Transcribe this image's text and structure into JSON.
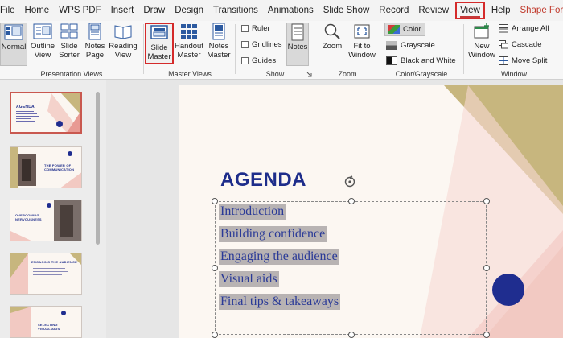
{
  "tabs": [
    {
      "label": "File"
    },
    {
      "label": "Home"
    },
    {
      "label": "WPS PDF"
    },
    {
      "label": "Insert"
    },
    {
      "label": "Draw"
    },
    {
      "label": "Design"
    },
    {
      "label": "Transitions"
    },
    {
      "label": "Animations"
    },
    {
      "label": "Slide Show"
    },
    {
      "label": "Record"
    },
    {
      "label": "Review"
    },
    {
      "label": "View"
    },
    {
      "label": "Help"
    },
    {
      "label": "Shape Format"
    }
  ],
  "ribbon": {
    "presentation_views": {
      "label": "Presentation Views",
      "normal": "Normal",
      "outline": [
        "Outline",
        "View"
      ],
      "sorter": [
        "Slide",
        "Sorter"
      ],
      "notes_page": [
        "Notes",
        "Page"
      ],
      "reading": [
        "Reading",
        "View"
      ]
    },
    "master_views": {
      "label": "Master Views",
      "slide_master": [
        "Slide",
        "Master"
      ],
      "handout_master": [
        "Handout",
        "Master"
      ],
      "notes_master": [
        "Notes",
        "Master"
      ]
    },
    "show": {
      "label": "Show",
      "ruler": "Ruler",
      "gridlines": "Gridlines",
      "guides": "Guides",
      "notes": "Notes"
    },
    "zoom": {
      "label": "Zoom",
      "zoom": "Zoom",
      "fit": [
        "Fit to",
        "Window"
      ]
    },
    "color": {
      "label": "Color/Grayscale",
      "color": "Color",
      "grayscale": "Grayscale",
      "bw": "Black and White"
    },
    "window": {
      "label": "Window",
      "new_window": [
        "New",
        "Window"
      ],
      "arrange_all": "Arrange All",
      "cascade": "Cascade",
      "move_split": "Move Split"
    }
  },
  "thumbnails": [
    {
      "title": "AGENDA"
    },
    {
      "title": "THE POWER OF COMMUNICATION"
    },
    {
      "title": "OVERCOMING NERVOUSNESS"
    },
    {
      "title": "ENGAGING THE AUDIENCE"
    },
    {
      "title": "SELECTING VISUAL AIDS"
    }
  ],
  "slide": {
    "title": "AGENDA",
    "lines": [
      "Introduction",
      "Building confidence",
      "Engaging the audience",
      "Visual aids",
      "Final tips & takeaways"
    ]
  },
  "colors": {
    "accent_red": "#d42a2a",
    "title_blue": "#1e2d8b",
    "olive": "#c7b67e",
    "pink": "#f2c9c2",
    "navy_dot": "#1f2d8f"
  }
}
